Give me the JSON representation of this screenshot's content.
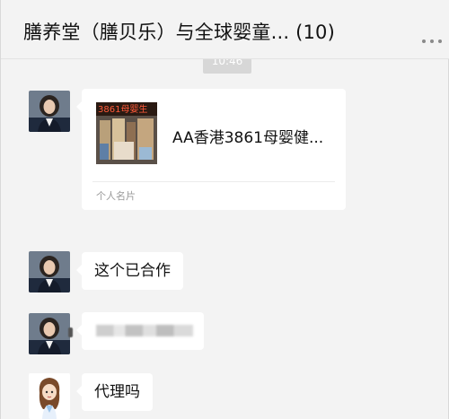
{
  "window": {
    "title": "膳养堂（膳贝乐）与全球婴童... (10)"
  },
  "chat": {
    "timestamp": "10:46",
    "messages": [
      {
        "kind": "contact-card",
        "card_name": "AA香港3861母婴健...",
        "card_type": "个人名片",
        "thumb_sign_text": "3861母婴生"
      },
      {
        "kind": "text",
        "text": "这个已合作"
      },
      {
        "kind": "text",
        "text": "",
        "redacted": true
      },
      {
        "kind": "text",
        "text": "代理吗"
      }
    ]
  },
  "icons": {
    "more": "more-dots-icon"
  },
  "colors": {
    "background": "#f3f3f3",
    "bubble": "#ffffff",
    "timestamp_bg": "#d7d7d7"
  }
}
